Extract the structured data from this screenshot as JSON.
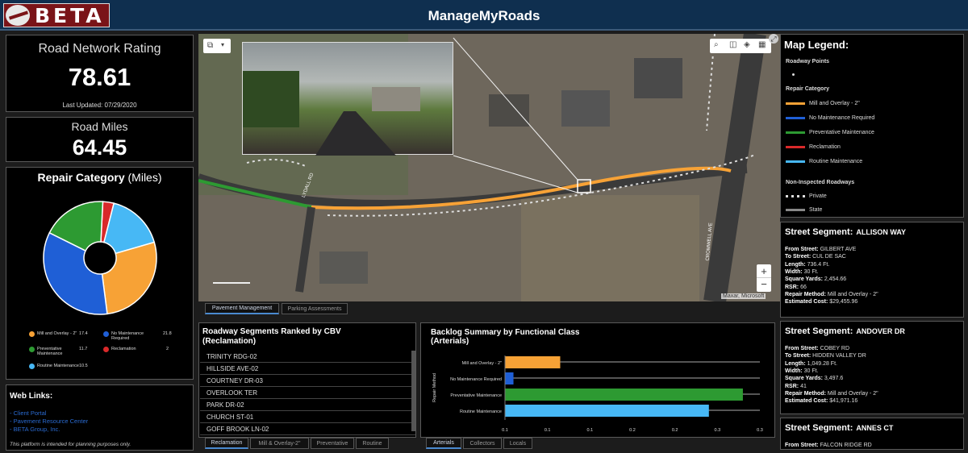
{
  "app": {
    "logo_text": "BETA",
    "title": "ManageMyRoads"
  },
  "rating": {
    "title": "Road Network Rating",
    "value": "78.61",
    "updated": "Last Updated: 07/29/2020"
  },
  "miles": {
    "title": "Road Miles",
    "value": "64.45"
  },
  "donut": {
    "title_bold": "Repair Category",
    "title_normal": "(Miles)",
    "legend": [
      {
        "label": "Mill and Overlay - 2\"",
        "value": "17.4",
        "color": "#f7a236"
      },
      {
        "label": "No Maintenance Required",
        "value": "21.8",
        "color": "#1f5fd6"
      },
      {
        "label": "Preventative Maintenance",
        "value": "11.7",
        "color": "#2d9a32"
      },
      {
        "label": "Reclamation",
        "value": "2",
        "color": "#d9292a"
      },
      {
        "label": "Routine Maintenance",
        "value": "10.5",
        "color": "#47b8f5"
      }
    ]
  },
  "weblinks": {
    "title": "Web Links:",
    "links": [
      "- Client Portal",
      "- Pavement Resource Center",
      "- BETA Group, Inc."
    ],
    "note": "This platform is intended for planning purposes only."
  },
  "map": {
    "attribution": "Maxar, Microsoft",
    "road_label_1": "LYDALL RD",
    "road_label_2": "CROMWELL AVE",
    "zoom_in": "+",
    "zoom_out": "−",
    "tabs": [
      "Pavement Management",
      "Parking Assessments"
    ]
  },
  "segments": {
    "title_line1": "Roadway Segments Ranked by CBV",
    "title_line2": "(Reclamation)",
    "rows": [
      "TRINITY RDG-02",
      "HILLSIDE AVE-02",
      "COURTNEY DR-03",
      "OVERLOOK TER",
      "PARK DR-02",
      "CHURCH ST-01",
      "GOFF BROOK LN-02"
    ],
    "tabs": [
      "Reclamation",
      "Mill & Overlay-2\"",
      "Preventative",
      "Routine"
    ]
  },
  "backlog": {
    "title_line1": "Backlog Summary by Functional Class",
    "title_line2": "(Arterials)",
    "tabs": [
      "Arterials",
      "Collectors",
      "Locals"
    ]
  },
  "map_legend": {
    "title": "Map Legend:",
    "roadway_points": "Roadway Points",
    "repair_category": "Repair Category",
    "items": [
      {
        "label": "Mill and Overlay - 2\"",
        "color": "#f7a236"
      },
      {
        "label": "No Maintenance Required",
        "color": "#1f5fd6"
      },
      {
        "label": "Preventative Maintenance",
        "color": "#2d9a32"
      },
      {
        "label": "Reclamation",
        "color": "#d9292a"
      },
      {
        "label": "Routine Maintenance",
        "color": "#47b8f5"
      }
    ],
    "non_inspected": "Non-Inspected Roadways",
    "private": "Private",
    "state": "State"
  },
  "street_segments": [
    {
      "heading": "Street Segment:",
      "name": "ALLISON WAY",
      "from": "GILBERT AVE",
      "to": "CUL DE SAC",
      "length": "736.4 Ft.",
      "width": "30 Ft.",
      "sq_yards": "2,454.66",
      "rsr": "66",
      "method": "Mill and Overlay - 2\"",
      "cost": "$29,455.96"
    },
    {
      "heading": "Street Segment:",
      "name": "ANDOVER DR",
      "from": "COBEY RD",
      "to": "HIDDEN VALLEY DR",
      "length": "1,049.28 Ft.",
      "width": "30 Ft.",
      "sq_yards": "3,497.6",
      "rsr": "41",
      "method": "Mill and Overlay - 2\"",
      "cost": "$41,971.16"
    },
    {
      "heading": "Street Segment:",
      "name": "ANNES CT",
      "from": "FALCON RIDGE RD"
    }
  ],
  "ss_labels": {
    "from": "From Street:",
    "to": "To Street:",
    "length": "Length:",
    "width": "Width:",
    "sq": "Square Yards:",
    "rsr": "RSR:",
    "method": "Repair Method:",
    "cost": "Estimated Cost:"
  },
  "chart_data": [
    {
      "type": "pie",
      "title": "Repair Category (Miles)",
      "categories": [
        "Mill and Overlay - 2\"",
        "No Maintenance Required",
        "Preventative Maintenance",
        "Reclamation",
        "Routine Maintenance"
      ],
      "values": [
        17.4,
        21.8,
        11.7,
        2,
        10.5
      ],
      "colors": [
        "#f7a236",
        "#1f5fd6",
        "#2d9a32",
        "#d9292a",
        "#47b8f5"
      ]
    },
    {
      "type": "bar",
      "orientation": "horizontal",
      "title": "Backlog Summary by Functional Class",
      "subtitle": "(Arterials)",
      "ylabel": "Repair Method",
      "categories": [
        "Mill and Overlay - 2\"",
        "No Maintenance Required",
        "Preventative Maintenance",
        "Routine Maintenance"
      ],
      "values": [
        0.13,
        0.02,
        0.56,
        0.48
      ],
      "colors": [
        "#f7a236",
        "#1f5fd6",
        "#2d9a32",
        "#47b8f5"
      ],
      "xticks": [
        "0.1",
        "0.1",
        "0.1",
        "0.2",
        "0.2",
        "0.3",
        "0.3"
      ],
      "xlim": [
        0,
        0.6
      ]
    }
  ]
}
